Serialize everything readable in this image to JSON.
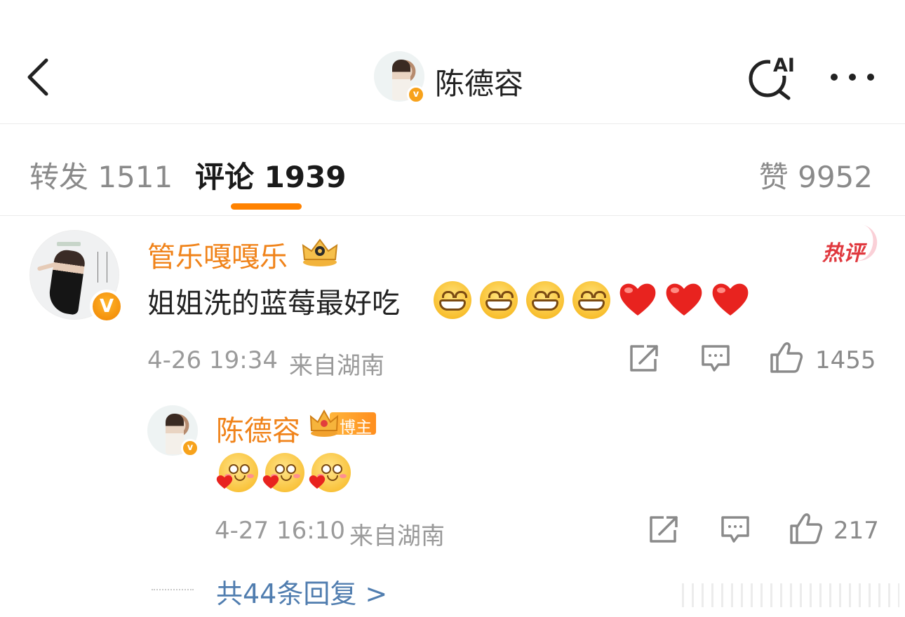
{
  "header": {
    "title": "陈德容",
    "avatar_verified": "v",
    "ai_label": "AI"
  },
  "tabs": {
    "repost": "转发 1511",
    "comments": "评论 1939",
    "likes": "赞 9952"
  },
  "comment": {
    "author": "管乐嘎嘎乐",
    "verified": "V",
    "hot_label": "热评",
    "text": "姐姐洗的蓝莓最好吃",
    "emojis": [
      "grin-emoji",
      "grin-emoji",
      "grin-emoji",
      "grin-emoji",
      "heart-emoji",
      "heart-emoji",
      "heart-emoji"
    ],
    "time": "4-26 19:34",
    "location": "来自湖南",
    "like_count": "1455"
  },
  "reply": {
    "author": "陈德容",
    "verified": "v",
    "author_badge": "博主",
    "emojis": [
      "love-emoji",
      "love-emoji",
      "love-emoji"
    ],
    "time": "4-27 16:10",
    "location": "来自湖南",
    "like_count": "217"
  },
  "more_replies": "共44条回复 >",
  "colors": {
    "accent": "#ff8200",
    "username": "#f0831a",
    "link": "#507daf",
    "hot": "#e0383e"
  }
}
